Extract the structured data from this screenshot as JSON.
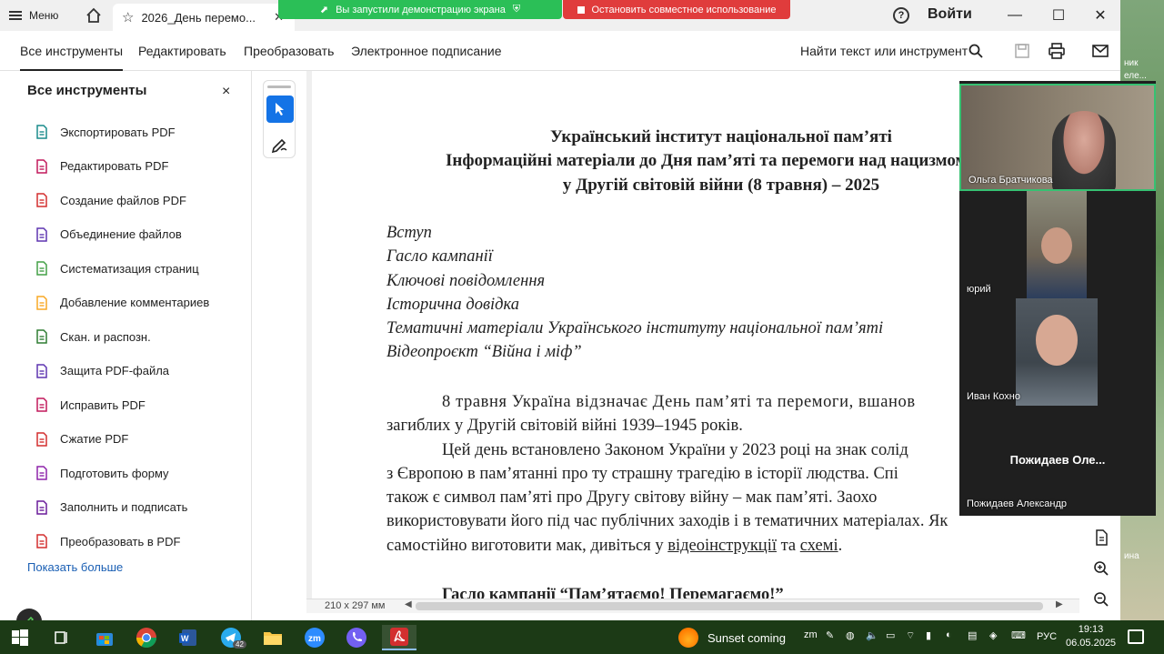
{
  "window": {
    "menu_label": "Меню",
    "tab_title": "2026_День перемо...",
    "help_label": "?",
    "signin_label": "Войти"
  },
  "share_banner": {
    "active_text": "Вы запустили демонстрацию экрана",
    "stop_text": "Остановить совместное использование"
  },
  "menubar": {
    "tabs": [
      "Все инструменты",
      "Редактировать",
      "Преобразовать",
      "Электронное подписание"
    ],
    "search_label": "Найти текст или инструмент"
  },
  "left_panel": {
    "title": "Все инструменты",
    "close": "×",
    "tools": [
      {
        "label": "Экспортировать PDF",
        "color": "#1a8c8c"
      },
      {
        "label": "Редактировать PDF",
        "color": "#c2185b"
      },
      {
        "label": "Создание файлов PDF",
        "color": "#d32f2f"
      },
      {
        "label": "Объединение файлов",
        "color": "#5e35b1"
      },
      {
        "label": "Систематизация страниц",
        "color": "#43a047"
      },
      {
        "label": "Добавление комментариев",
        "color": "#f9a825"
      },
      {
        "label": "Скан. и распозн.",
        "color": "#2e7d32"
      },
      {
        "label": "Защита PDF-файла",
        "color": "#5e35b1"
      },
      {
        "label": "Исправить PDF",
        "color": "#c2185b"
      },
      {
        "label": "Сжатие PDF",
        "color": "#d32f2f"
      },
      {
        "label": "Подготовить форму",
        "color": "#8e24aa"
      },
      {
        "label": "Заполнить и подписать",
        "color": "#6a1b9a"
      },
      {
        "label": "Преобразовать в PDF",
        "color": "#d32f2f"
      }
    ],
    "show_more": "Показать больше"
  },
  "document": {
    "heading": [
      "Український інститут національної пам’яті",
      "Інформаційні матеріали до Дня пам’яті та перемоги над нацизмом",
      "у Другій світовій війни (8 травня) – 2025"
    ],
    "toc": [
      "Вступ",
      "Гасло кампанії",
      "Ключові повідомлення",
      "Історична довідка",
      "Тематичні матеріали Українського інституту національної пам’яті",
      "Відеопроєкт “Війна і міф”"
    ],
    "para1_line1": "8 травня Україна відзначає День пам’яті та перемоги, вшанов",
    "para1_line2": "загиблих у Другій світовій війні 1939–1945 років.",
    "para2_line1": "Цей день встановлено Законом України у 2023 році на знак солід",
    "para2_line2": "з Європою в пам’ятанні про ту страшну трагедію в історії людства. Спі",
    "para2_line3": "також є символ пам’яті про Другу світову війну – мак пам’яті. Заохо",
    "para2_line4": "використовувати його під час публічних заходів і в тематичних матеріалах. Як",
    "para2_line5_a": "самостійно виготовити мак, дивіться у ",
    "para2_line5_link1": "відеоінструкції",
    "para2_line5_b": " та ",
    "para2_line5_link2": "схемі",
    "para2_line5_c": ".",
    "section_title": "Гасло кампанії “Пам’ятаємо! Перемагаємо!”",
    "page_size": "210 x 297 мм"
  },
  "video": {
    "participants": [
      {
        "name": "Ольга Братчикова"
      },
      {
        "name": "юрий"
      },
      {
        "name": "Иван Кохно"
      },
      {
        "name": "Пожидаев Александр",
        "big_label": "Пожидаев  Оле..."
      }
    ]
  },
  "taskbar": {
    "weather": "Sunset coming",
    "telegram_badge": "42",
    "lang": "РУС",
    "time": "19:13",
    "date": "06.05.2025"
  },
  "desktop": {
    "labels": [
      "ник",
      "еле...",
      "ина"
    ]
  }
}
